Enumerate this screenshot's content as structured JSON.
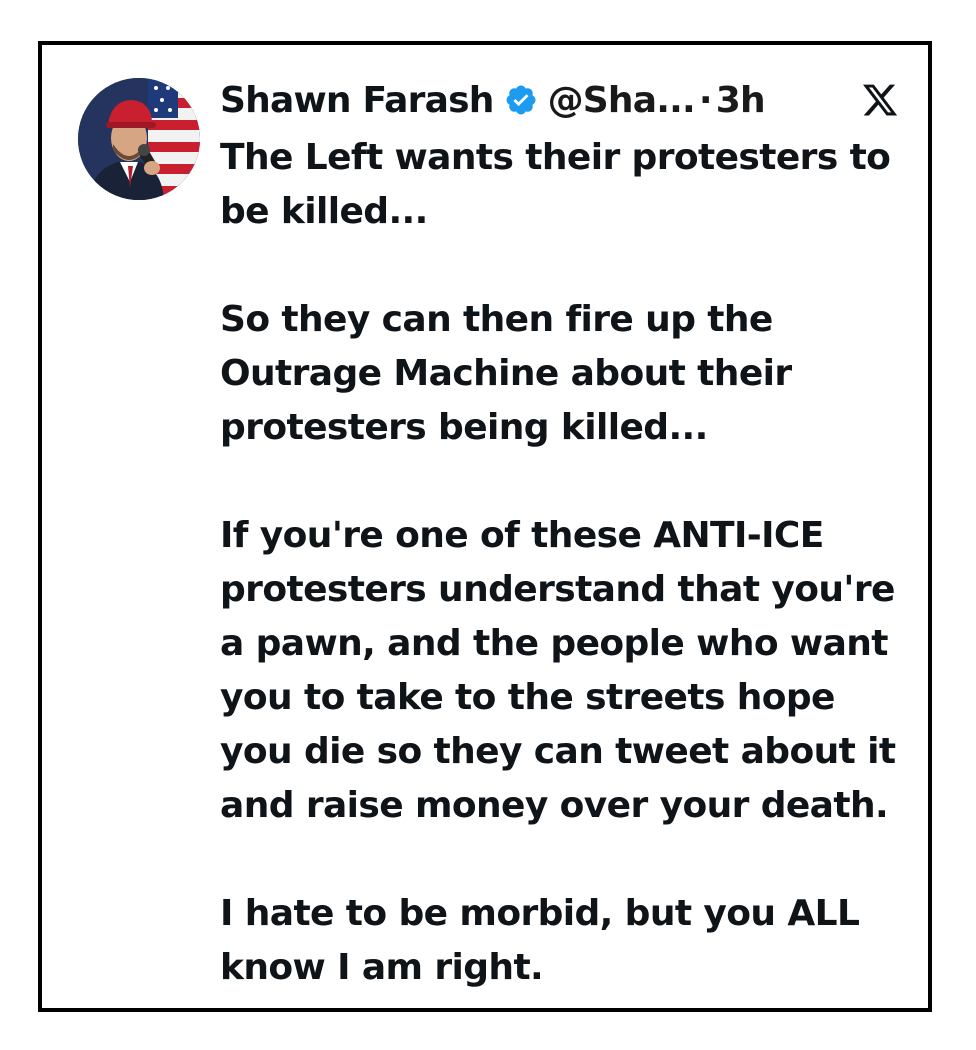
{
  "tweet": {
    "author_name": "Shawn Farash",
    "handle": "@Sha...",
    "separator": "·",
    "time": "3h",
    "paragraphs": [
      "The Left wants their protesters to\nbe killed...",
      "So they can then fire up the\nOutrage Machine about their\nprotesters being killed...",
      "If you're one of these ANTI-ICE\nprotesters understand that you're\na pawn, and the people who want\nyou to take to the streets hope\nyou die so they can tweet about it\nand raise money over your death.",
      "I hate to be morbid, but you ALL\nknow I am right."
    ]
  },
  "icons": {
    "verified": "verified-badge-icon",
    "platform": "x-logo-icon"
  },
  "colors": {
    "text": "#0f1419",
    "verified_blue": "#1d9bf0",
    "frame_border": "#000000"
  }
}
